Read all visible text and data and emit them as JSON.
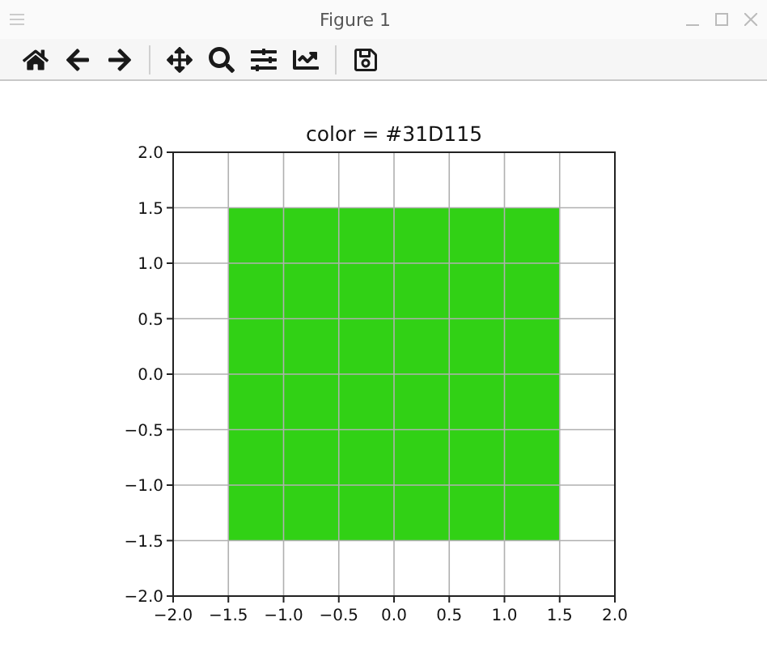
{
  "window": {
    "title": "Figure 1"
  },
  "figure": {
    "chart_data": {
      "type": "area",
      "title": "color = #31D115",
      "x": [
        -1.5,
        1.5
      ],
      "series": [
        {
          "color": "#31d115",
          "values": [
            1.5,
            1.5
          ]
        },
        {
          "color": "#31d115",
          "values": [
            -1.5,
            -1.5
          ]
        }
      ],
      "grid": true,
      "xlim": [
        -2,
        2
      ],
      "ylim": [
        -2,
        2
      ],
      "xticks": [
        {
          "value": -2,
          "label": "−2.0"
        },
        {
          "value": -1.5,
          "label": "−1.5"
        },
        {
          "value": -1,
          "label": "−1.0"
        },
        {
          "value": -0.5,
          "label": "−0.5"
        },
        {
          "value": 0,
          "label": "0.0"
        },
        {
          "value": 0.5,
          "label": "0.5"
        },
        {
          "value": 1,
          "label": "1.0"
        },
        {
          "value": 1.5,
          "label": "1.5"
        },
        {
          "value": 2,
          "label": "2.0"
        }
      ],
      "yticks": [
        {
          "value": -2,
          "label": "−2.0"
        },
        {
          "value": -1.5,
          "label": "−1.5"
        },
        {
          "value": -1,
          "label": "−1.0"
        },
        {
          "value": -0.5,
          "label": "−0.5"
        },
        {
          "value": 0,
          "label": "0.0"
        },
        {
          "value": 0.5,
          "label": "0.5"
        },
        {
          "value": 1,
          "label": "1.0"
        },
        {
          "value": 1.5,
          "label": "1.5"
        },
        {
          "value": 2,
          "label": "2.0"
        }
      ]
    }
  }
}
